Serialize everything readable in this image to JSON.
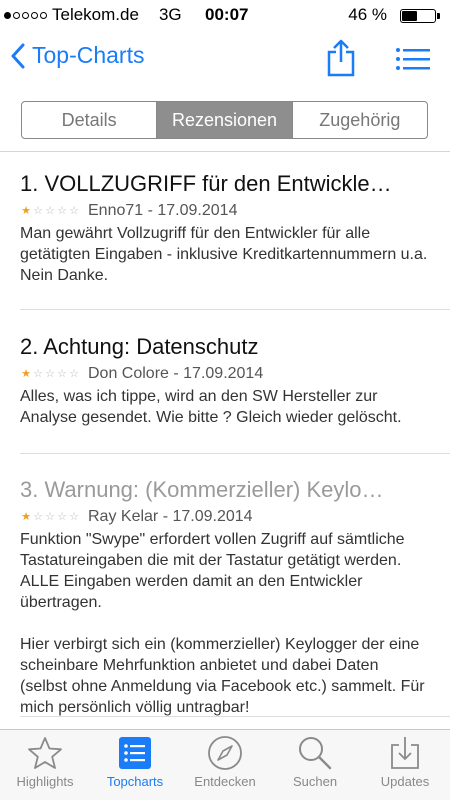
{
  "status": {
    "carrier": "Telekom.de",
    "network": "3G",
    "time": "00:07",
    "battery_percent": "46 %",
    "battery_level": 0.46,
    "signal_bars_filled": 1
  },
  "nav": {
    "back_label": "Top-Charts",
    "accent_color": "#1a7cf7",
    "share_icon": "share-icon",
    "list_icon": "list-icon"
  },
  "segments": {
    "items": [
      "Details",
      "Rezensionen",
      "Zugehörig"
    ],
    "selected": "Rezensionen"
  },
  "reviews": [
    {
      "title": "1. VOLLZUGRIFF für den Entwickle…",
      "rating": 1,
      "meta": "Enno71 - 17.09.2014",
      "body": [
        "Man gewährt Vollzugriff für den Entwickler für alle getätigten Eingaben - inklusive Kreditkartennummern u.a.",
        "Nein Danke."
      ]
    },
    {
      "title": "2. Achtung: Datenschutz",
      "rating": 1,
      "meta": "Don Colore - 17.09.2014",
      "body": [
        "Alles, was ich tippe, wird an den SW Hersteller zur Analyse gesendet. Wie bitte ? Gleich wieder gelöscht."
      ]
    },
    {
      "title": "3. Warnung: (Kommerzieller) Keylo…",
      "rating": 1,
      "meta": "Ray Kelar - 17.09.2014",
      "body": [
        "Funktion \"Swype\" erfordert vollen Zugriff auf sämtliche Tastatureingaben die mit der Tastatur getätigt werden. ALLE Eingaben werden damit an den Entwickler übertragen.",
        "Hier verbirgt sich ein (kommerzieller) Keylogger der eine scheinbare Mehrfunktion anbietet und dabei Daten (selbst ohne Anmeldung via Facebook etc.) sammelt. Für mich persönlich völlig untragbar!"
      ]
    }
  ],
  "tabs": {
    "highlights": "Highlights",
    "topcharts": "Topcharts",
    "entdecken": "Entdecken",
    "suchen": "Suchen",
    "updates": "Updates",
    "active": "Topcharts"
  }
}
